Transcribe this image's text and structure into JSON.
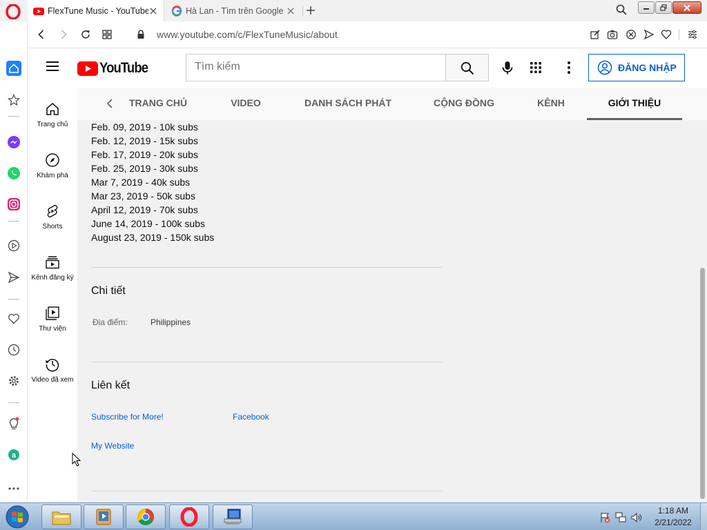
{
  "browser": {
    "tabs": [
      {
        "title": "FlexTune Music - YouTube",
        "active": true,
        "favicon": "youtube-icon"
      },
      {
        "title": "Hà Lan - Tìm trên Google",
        "active": false,
        "favicon": "google-icon"
      }
    ],
    "url": "www.youtube.com/c/FlexTuneMusic/about"
  },
  "opera_sidebar": [
    "home-icon",
    "star-icon",
    "messenger-icon",
    "whatsapp-icon",
    "instagram-icon",
    "player-icon",
    "send-icon",
    "heart-icon",
    "history-icon",
    "settings-icon",
    "lightbulb-icon",
    "aria-icon",
    "more-icon"
  ],
  "youtube": {
    "logo_text": "YouTube",
    "search_placeholder": "Tìm kiếm",
    "signin_label": "ĐĂNG NHẬP",
    "guide": [
      {
        "label": "Trang chủ",
        "icon": "home-icon"
      },
      {
        "label": "Khám phá",
        "icon": "compass-icon"
      },
      {
        "label": "Shorts",
        "icon": "shorts-icon"
      },
      {
        "label": "Kênh đăng ký",
        "icon": "subscriptions-icon"
      },
      {
        "label": "Thư viện",
        "icon": "library-icon"
      },
      {
        "label": "Video đã xem",
        "icon": "history-icon"
      }
    ],
    "channel_tabs": [
      {
        "label": "TRANG CHỦ",
        "active": false
      },
      {
        "label": "VIDEO",
        "active": false
      },
      {
        "label": "DANH SÁCH PHÁT",
        "active": false
      },
      {
        "label": "CỘNG ĐỒNG",
        "active": false
      },
      {
        "label": "KÊNH",
        "active": false
      },
      {
        "label": "GIỚI THIỆU",
        "active": true
      }
    ]
  },
  "about": {
    "milestones": [
      "Feb. 09, 2019 - 10k subs",
      "Feb. 12, 2019 - 15k subs",
      "Feb. 17, 2019 - 20k subs",
      "Feb. 25, 2019 - 30k subs",
      "Mar 7, 2019 - 40k subs",
      "Mar 23, 2019 - 50k subs",
      "April 12, 2019 - 70k subs",
      "June 14, 2019 - 100k subs",
      "August 23, 2019 - 150k subs"
    ],
    "details_title": "Chi tiết",
    "location_label": "Địa điểm:",
    "location_value": "Philippines",
    "links_title": "Liên kết",
    "links": [
      "Subscribe for More!",
      "Facebook",
      "My Website"
    ]
  },
  "taskbar": {
    "apps": [
      "file-explorer-icon",
      "media-player-icon",
      "chrome-icon",
      "opera-icon",
      "network-icon"
    ],
    "time": "1:18 AM",
    "date": "2/21/2022"
  },
  "colors": {
    "youtube_red": "#ff0000",
    "link_blue": "#065fd4",
    "opera_red": "#ff1b2d"
  }
}
